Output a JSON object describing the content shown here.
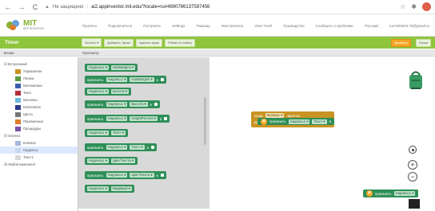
{
  "browser": {
    "back_icon": "←",
    "forward_icon": "→",
    "reload_icon": "C",
    "security_label": "Не защищено",
    "url": "ai2.appinventor.mit.edu/?locale=ru#4690786137587456"
  },
  "header": {
    "logo_title": "MIT",
    "logo_subtitle": "APP INVENTOR",
    "menu": [
      "Проекты",
      "Подключиться",
      "Построить",
      "Settings",
      "Помощь",
      "Мои проекты",
      "View Trash",
      "Руководство",
      "Сообщить о проблеме",
      "Русский",
      "rus.bektash.79@gmail.ru"
    ]
  },
  "toolbar": {
    "project_name": "Timer",
    "buttons": [
      "Screen1 ▾",
      "Добавить Экран",
      "Удалить экран",
      "Publish to Gallery"
    ],
    "right_buttons": [
      "Дизайнер",
      "Блоки"
    ]
  },
  "panels": {
    "blocks_header": "Блоки",
    "viewer_header": "Просмотр"
  },
  "tree": [
    {
      "label": "Встроенный",
      "toggle": "⊟",
      "indent": 0,
      "color": ""
    },
    {
      "label": "Управление",
      "toggle": "",
      "indent": 1,
      "color": "#c99422"
    },
    {
      "label": "Логика",
      "toggle": "",
      "indent": 1,
      "color": "#5b9b45"
    },
    {
      "label": "Математика",
      "toggle": "",
      "indent": 1,
      "color": "#3e5fb0"
    },
    {
      "label": "Текст",
      "toggle": "",
      "indent": 1,
      "color": "#b32d3c"
    },
    {
      "label": "Массивы",
      "toggle": "",
      "indent": 1,
      "color": "#6cb9dd"
    },
    {
      "label": "Dictionaries",
      "toggle": "",
      "indent": 1,
      "color": "#2d3a8a"
    },
    {
      "label": "Цвета",
      "toggle": "",
      "indent": 1,
      "color": "#777777"
    },
    {
      "label": "Переменные",
      "toggle": "",
      "indent": 1,
      "color": "#e07b2a"
    },
    {
      "label": "Процедуры",
      "toggle": "",
      "indent": 1,
      "color": "#7a4fa8"
    },
    {
      "label": "Screen1",
      "toggle": "⊟",
      "indent": 0,
      "color": ""
    },
    {
      "label": "Кнопка1",
      "toggle": "",
      "indent": 1,
      "color": "#a5b8d8"
    },
    {
      "label": "Надпись1",
      "toggle": "",
      "indent": 1,
      "color": "#c6d8ee"
    },
    {
      "label": "Текст1",
      "toggle": "",
      "indent": 1,
      "color": "#d8d8d8"
    },
    {
      "label": "Любой компонент",
      "toggle": "⊞",
      "indent": 0,
      "color": ""
    }
  ],
  "flyout_blocks": [
    {
      "type": "get",
      "component": "Надпись1",
      "prop": "HasMargins"
    },
    {
      "type": "set",
      "verb": "присвоить",
      "component": "Надпись1",
      "prop": "HasMargins",
      "to": "в"
    },
    {
      "type": "get",
      "component": "Надпись1",
      "prop": "Высота"
    },
    {
      "type": "set",
      "verb": "присвоить",
      "component": "Надпись1",
      "prop": "Высота",
      "to": "в"
    },
    {
      "type": "set",
      "verb": "присвоить",
      "component": "Надпись1",
      "prop": "HeightPercent",
      "to": "в"
    },
    {
      "type": "get",
      "component": "Надпись1",
      "prop": "Текст"
    },
    {
      "type": "set",
      "verb": "присвоить",
      "component": "Надпись1",
      "prop": "Текст",
      "to": "в"
    },
    {
      "type": "get",
      "component": "Надпись1",
      "prop": "ЦветТекста"
    },
    {
      "type": "set",
      "verb": "присвоить",
      "component": "Надпись1",
      "prop": "ЦветТекста",
      "to": "в"
    },
    {
      "type": "get",
      "component": "Надпись1",
      "prop": "Видимый"
    }
  ],
  "workspace": {
    "event": {
      "when": "когда",
      "component": "Кнопка1",
      "event": ".Щелчок",
      "do": "делать"
    },
    "inner": {
      "verb": "присвоить",
      "component": "Надпись1",
      "prop": "Текст",
      "to": "в"
    },
    "floating": {
      "verb": "присвоить",
      "component": "Надпись1"
    },
    "zoom_in": "+",
    "zoom_out": "−"
  }
}
